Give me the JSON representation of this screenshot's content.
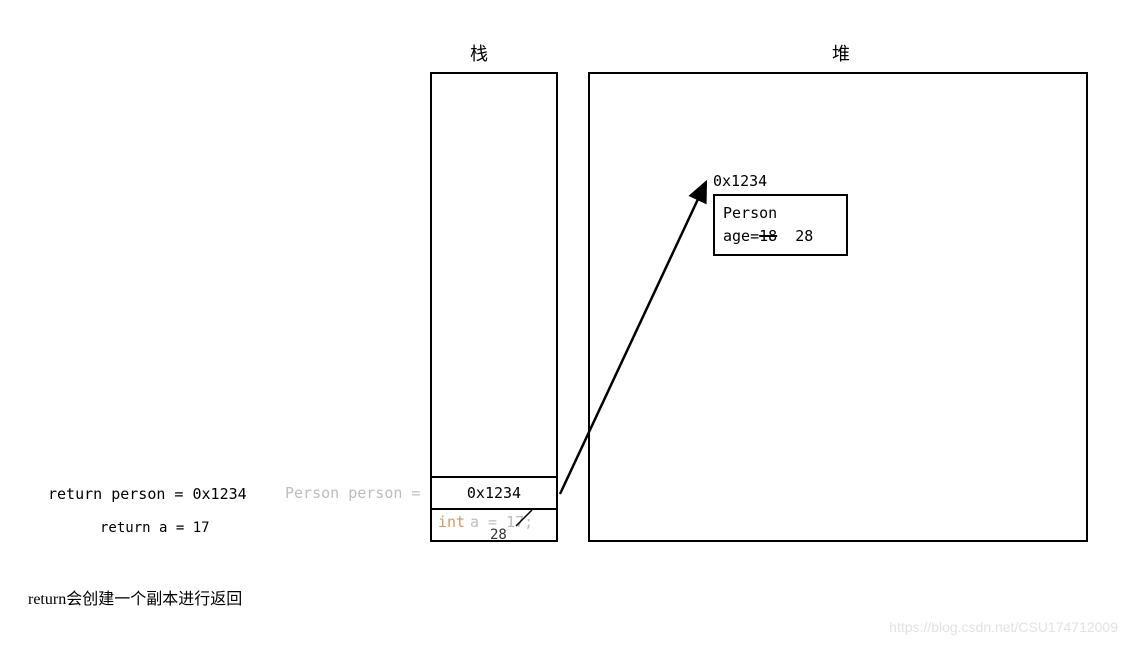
{
  "titles": {
    "stack": "栈",
    "heap": "堆"
  },
  "stack": {
    "row1_value": "0x1234",
    "row2_updated": "28"
  },
  "declarations": {
    "person_decl": "Person person =",
    "int_keyword": "int",
    "a_decl_rest": " a = 17;"
  },
  "heap": {
    "address": "0x1234",
    "obj_line1": "Person",
    "age_prefix": "age=",
    "age_old": "18",
    "age_new": "28"
  },
  "returns": {
    "line1": "return person = 0x1234",
    "line2": "return a = 17"
  },
  "note": "return会创建一个副本进行返回",
  "watermark": "https://blog.csdn.net/CSU174712009"
}
